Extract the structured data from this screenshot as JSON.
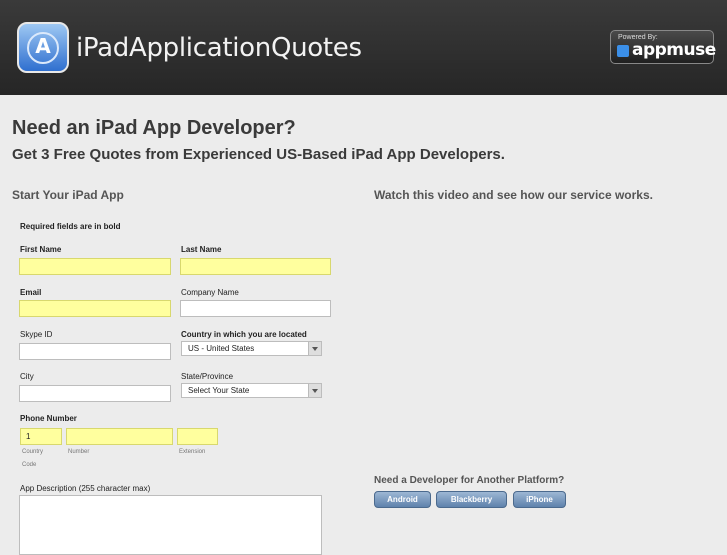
{
  "header": {
    "title": "iPadApplicationQuotes",
    "logo_letter": "A",
    "badge_powered": "Powered By:",
    "badge_name": "appmuse",
    "accent_color": "#3b8fe8"
  },
  "main": {
    "heading": "Need an iPad App Developer?",
    "subheading": "Get 3 Free Quotes from Experienced US-Based iPad App Developers."
  },
  "form": {
    "section_title": "Start Your iPad App",
    "required_note": "Required fields are in bold",
    "first_name_label": "First Name",
    "last_name_label": "Last Name",
    "email_label": "Email",
    "company_label": "Company Name",
    "skype_label": "Skype ID",
    "country_label": "Country in which you are located",
    "country_value": "US - United States",
    "city_label": "City",
    "state_label": "State/Province",
    "state_value": "Select Your State",
    "phone_label": "Phone Number",
    "country_code_value": "1",
    "country_code_label": "Country Code",
    "number_label": "Number",
    "extension_label": "Extension",
    "description_label": "App Description (255 character max)"
  },
  "side": {
    "video_title": "Watch this video and see how our service works.",
    "platform_title": "Need a Developer for Another Platform?",
    "platforms": [
      "Android",
      "Blackberry",
      "iPhone"
    ]
  },
  "colors": {
    "required_field": "#ffff9e",
    "platform_button": "#7a98bd",
    "header_bg": "#2e2e2e"
  }
}
